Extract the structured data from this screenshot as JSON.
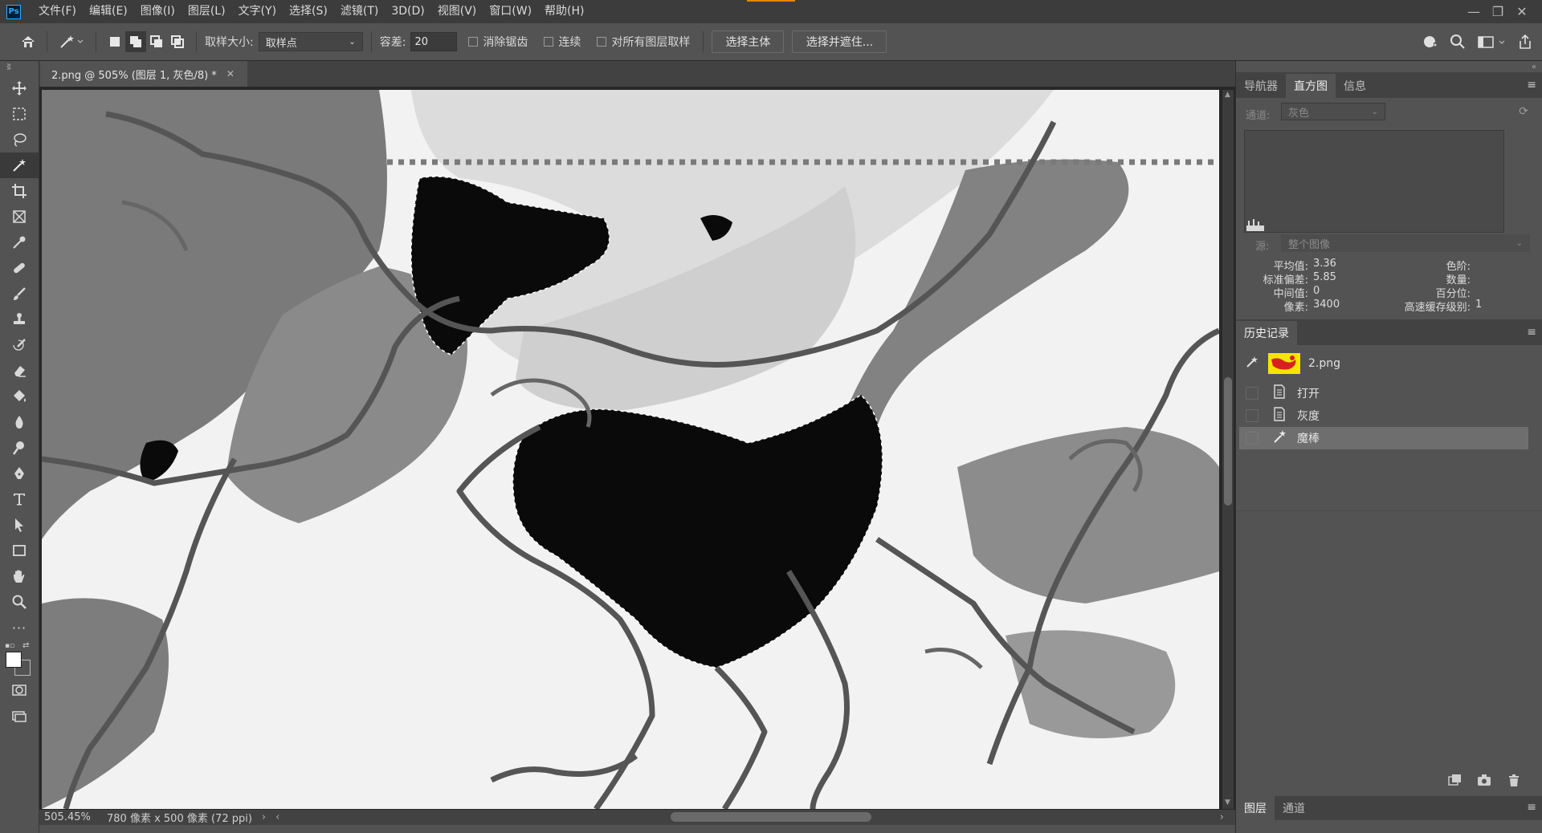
{
  "app": {
    "logo": "Ps"
  },
  "menu": [
    "文件(F)",
    "编辑(E)",
    "图像(I)",
    "图层(L)",
    "文字(Y)",
    "选择(S)",
    "滤镜(T)",
    "3D(D)",
    "视图(V)",
    "窗口(W)",
    "帮助(H)"
  ],
  "options": {
    "sample_size_label": "取样大小:",
    "sample_size_value": "取样点",
    "tolerance_label": "容差:",
    "tolerance_value": "20",
    "anti_alias_label": "消除锯齿",
    "contiguous_label": "连续",
    "sample_all_label": "对所有图层取样",
    "select_subject": "选择主体",
    "select_mask": "选择并遮住..."
  },
  "document": {
    "tab_title": "2.png @ 505% (图层 1, 灰色/8) *",
    "zoom": "505.45%",
    "doc_info": "780 像素 x 500 像素 (72 ppi)"
  },
  "histogram_panel": {
    "tabs": [
      "导航器",
      "直方图",
      "信息"
    ],
    "channel_label": "通道:",
    "channel_value": "灰色",
    "source_label": "源:",
    "source_value": "整个图像",
    "stats": {
      "mean_label": "平均值:",
      "mean": "3.36",
      "std_label": "标准偏差:",
      "std": "5.85",
      "median_label": "中间值:",
      "median": "0",
      "pixels_label": "像素:",
      "pixels": "3400",
      "level_label": "色阶:",
      "count_label": "数量:",
      "percentile_label": "百分位:",
      "cache_label": "高速缓存级别:",
      "cache": "1"
    }
  },
  "history_panel": {
    "title": "历史记录",
    "snapshot": "2.png",
    "items": [
      "打开",
      "灰度",
      "魔棒"
    ]
  },
  "layers_panel": {
    "tabs": [
      "图层",
      "通道"
    ]
  },
  "colors": {
    "accent": "#31a8ff",
    "menubar": "#3c3c3c",
    "panel": "#535353"
  }
}
